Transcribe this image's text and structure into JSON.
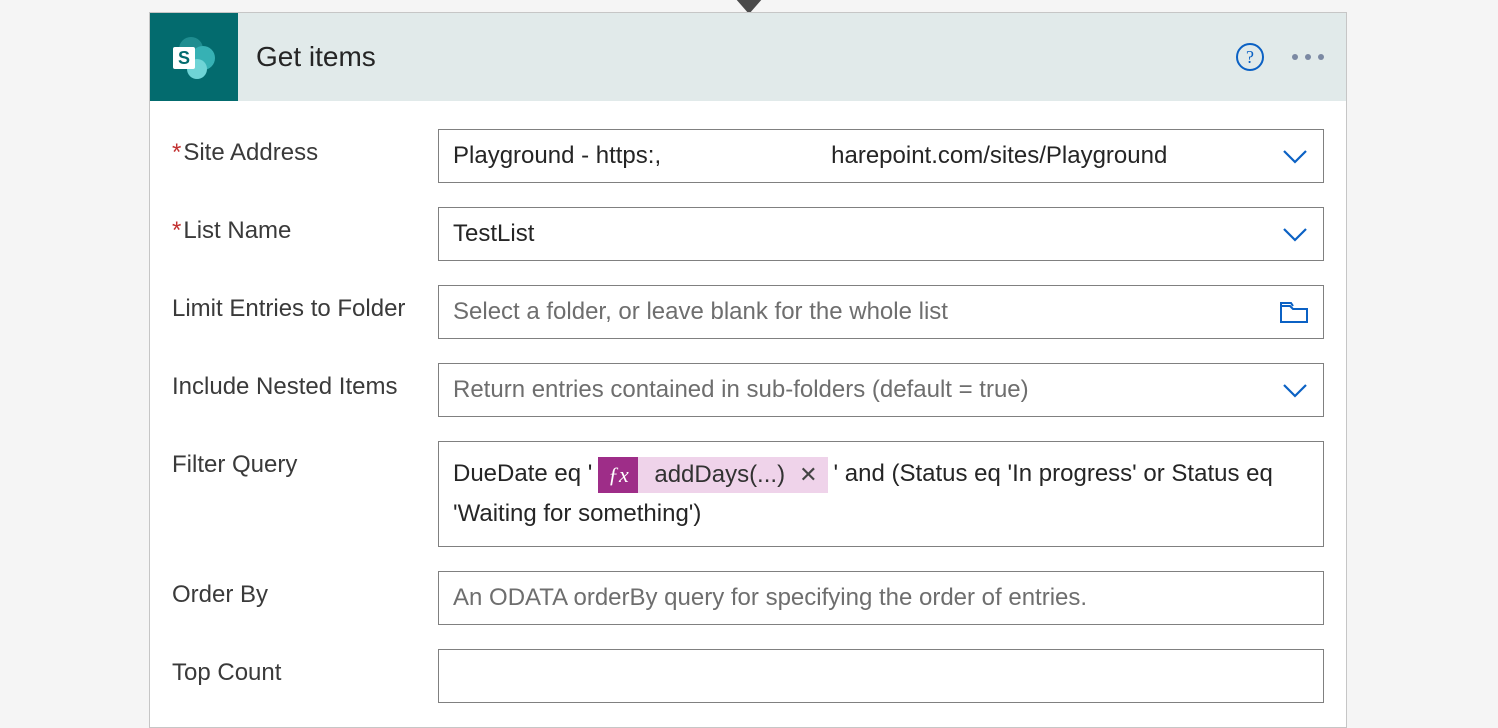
{
  "header": {
    "title": "Get items"
  },
  "fields": {
    "siteAddress": {
      "label": "Site Address",
      "required": true,
      "valueLeft": "Playground - https:,",
      "valueRight": "harepoint.com/sites/Playground"
    },
    "listName": {
      "label": "List Name",
      "required": true,
      "value": "TestList"
    },
    "limitFolder": {
      "label": "Limit Entries to Folder",
      "placeholder": "Select a folder, or leave blank for the whole list"
    },
    "includeNested": {
      "label": "Include Nested Items",
      "placeholder": "Return entries contained in sub-folders (default = true)"
    },
    "filterQuery": {
      "label": "Filter Query",
      "prefix": "DueDate eq '",
      "tokenLabel": "addDays(...)",
      "suffix": "' and (Status eq 'In progress' or Status eq 'Waiting for something')"
    },
    "orderBy": {
      "label": "Order By",
      "placeholder": "An ODATA orderBy query for specifying the order of entries."
    },
    "topCount": {
      "label": "Top Count"
    }
  }
}
